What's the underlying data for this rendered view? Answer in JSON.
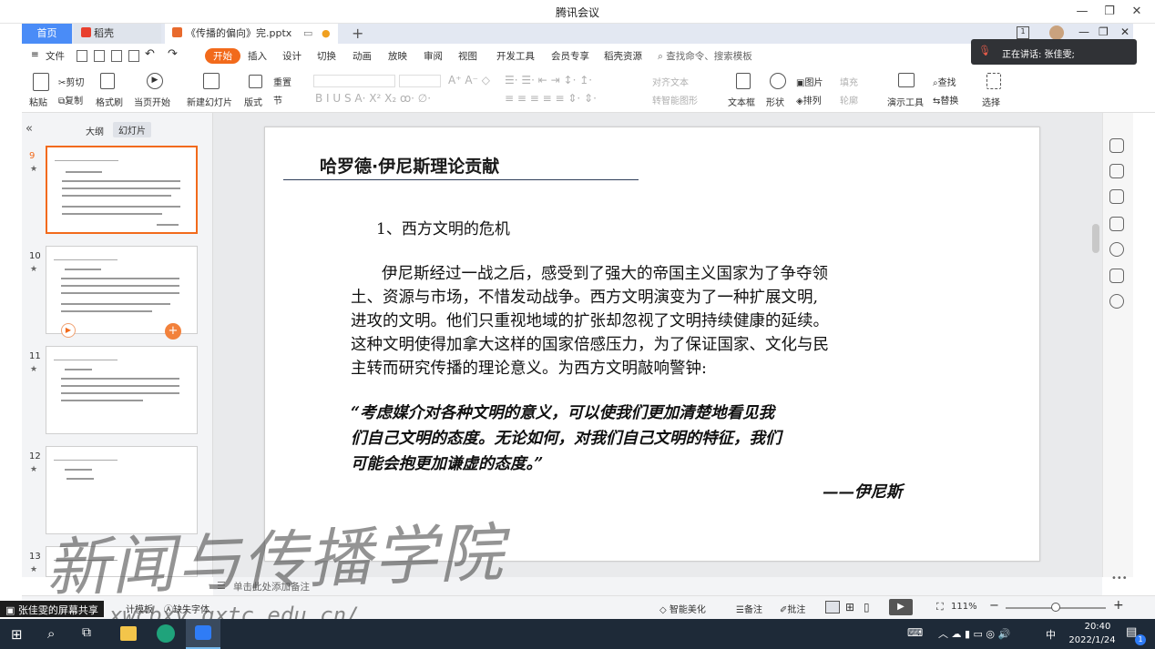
{
  "meeting": {
    "title": "腾讯会议",
    "speaking": "正在讲话: 张佳雯;"
  },
  "tabs": [
    {
      "label": "首页"
    },
    {
      "label": "稻壳"
    },
    {
      "label": "《传播的偏向》完.pptx"
    }
  ],
  "menu": {
    "file": "文件",
    "items": [
      "开始",
      "插入",
      "设计",
      "切换",
      "动画",
      "放映",
      "审阅",
      "视图",
      "开发工具",
      "会员专享",
      "稻壳资源"
    ],
    "search": "查找命令、搜索模板"
  },
  "ribbon": {
    "paste": "粘贴",
    "cut": "剪切",
    "copy": "复制",
    "format_painter": "格式刷",
    "play_from_current": "当页开始",
    "new_slide": "新建幻灯片",
    "layout": "版式",
    "section": "节",
    "reset": "重置",
    "align_text": "对齐文本",
    "smart_art": "转智能图形",
    "textbox": "文本框",
    "shape": "形状",
    "image": "图片",
    "arrange": "排列",
    "fill": "填充",
    "outline": "轮廓",
    "presentation_tools": "演示工具",
    "find": "查找",
    "replace": "替换",
    "select": "选择"
  },
  "left_pane": {
    "outline_tab": "大纲",
    "slides_tab": "幻灯片",
    "thumbs": [
      {
        "num": "9"
      },
      {
        "num": "10"
      },
      {
        "num": "11"
      },
      {
        "num": "12"
      },
      {
        "num": "13"
      }
    ]
  },
  "slide": {
    "title": "哈罗德·伊尼斯理论贡献",
    "heading": "1、西方文明的危机",
    "paragraph_lines": [
      "伊尼斯经过一战之后，感受到了强大的帝国主义国家为了争夺领",
      "土、资源与市场，不惜发动战争。西方文明演变为了一种扩展文明,",
      "进攻的文明。他们只重视地域的扩张却忽视了文明持续健康的延续。",
      "这种文明使得加拿大这样的国家倍感压力，为了保证国家、文化与民",
      "主转而研究传播的理论意义。为西方文明敲响警钟:"
    ],
    "quote_lines": [
      "“考虑媒介对各种文明的意义，可以使我们更加清楚地看见我",
      "们自己文明的态度。无论如何，对我们自己文明的特征，我们",
      "可能会抱更加谦虚的态度。”"
    ],
    "attribution": "——伊尼斯"
  },
  "notes_placeholder": "单击此处添加备注",
  "status": {
    "screen_share": "张佳雯的屏幕共享",
    "template": "计模板",
    "missing_font": "缺失字体",
    "beautify": "智能美化",
    "notes": "备注",
    "comment": "批注",
    "zoom": "111%"
  },
  "watermark": {
    "text": "新闻与传播学院",
    "url": "xwcbxy.gxtc.edu.cn/"
  },
  "taskbar": {
    "ime": "中",
    "time": "20:40",
    "date": "2022/1/24",
    "notif_count": "1"
  }
}
